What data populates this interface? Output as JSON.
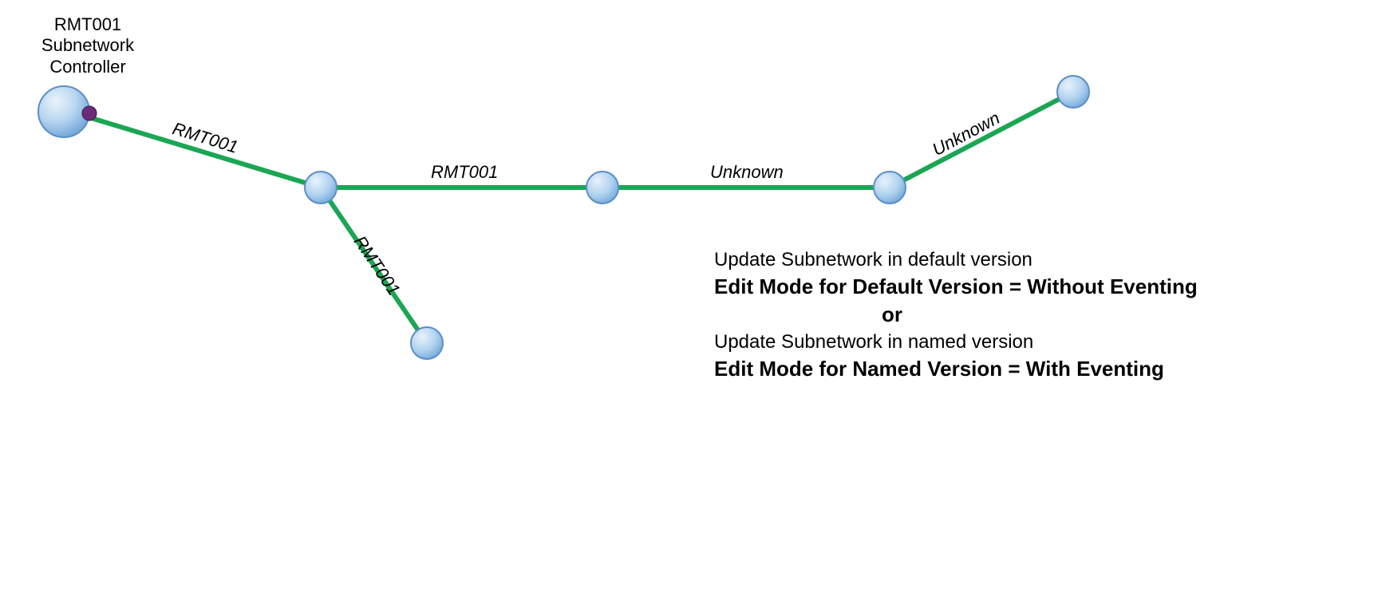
{
  "controller": {
    "label_line1": "RMT001",
    "label_line2": "Subnetwork",
    "label_line3": "Controller"
  },
  "edges": {
    "e1": "RMT001",
    "e2": "RMT001",
    "e3": "RMT001",
    "e4": "Unknown",
    "e5": "Unknown"
  },
  "info": {
    "line1": "Update Subnetwork in default version",
    "line2": "Edit Mode for Default Version = Without Eventing",
    "or": "or",
    "line3": "Update Subnetwork in named version",
    "line4": "Edit Mode for Named Version = With Eventing"
  },
  "colors": {
    "edge": "#1aa653",
    "node_fill_light": "#cde4f7",
    "node_fill_dark": "#8bbce6",
    "node_stroke": "#5a8fc7",
    "controller_dot": "#6b2a7a"
  }
}
